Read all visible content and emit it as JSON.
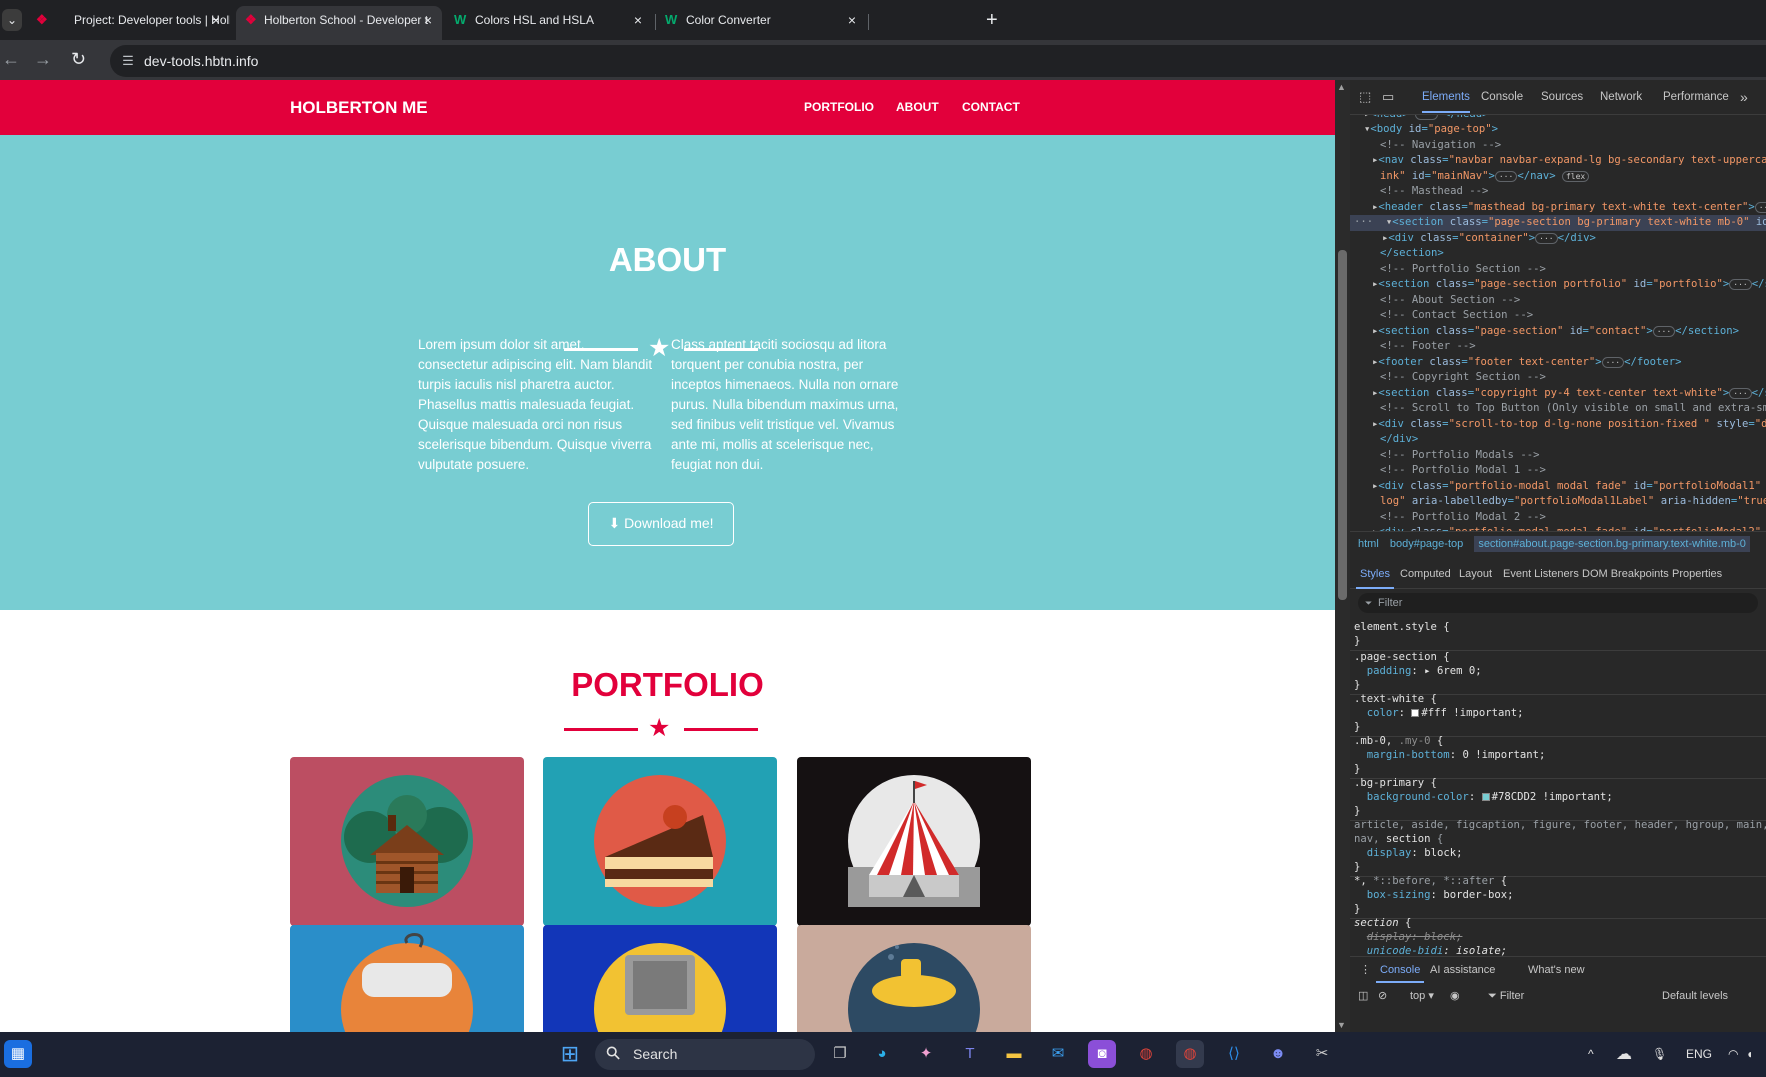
{
  "browser": {
    "tabs": [
      {
        "title": "Project: Developer tools | Holbe",
        "favicon": "holberton-icon",
        "close": "×"
      },
      {
        "title": "Holberton School - Developer t",
        "favicon": "holberton-icon",
        "close": "×"
      },
      {
        "title": "Colors HSL and HSLA",
        "favicon": "w3schools-icon",
        "close": "×"
      },
      {
        "title": "Color Converter",
        "favicon": "w3schools-icon",
        "close": "×"
      }
    ],
    "url": "dev-tools.hbtn.info"
  },
  "site": {
    "brand": "HOLBERTON ME",
    "nav": [
      "PORTFOLIO",
      "ABOUT",
      "CONTACT"
    ],
    "about": {
      "title": "ABOUT",
      "col1": "Lorem ipsum dolor sit amet, consectetur adipiscing elit. Nam blandit turpis iaculis nisl pharetra auctor. Phasellus mattis malesuada feugiat. Quisque malesuada orci non risus scelerisque bibendum. Quisque viverra vulputate posuere.",
      "col2": "Class aptent taciti sociosqu ad litora torquent per conubia nostra, per inceptos himenaeos. Nulla non ornare purus. Nulla bibendum maximus urna, sed finibus velit tristique vel. Vivamus ante mi, mollis at scelerisque nec, feugiat non dui.",
      "download": "Download me!",
      "background": "#78CDD2"
    },
    "portfolio": {
      "title": "PORTFOLIO",
      "items": [
        "cabin",
        "cake",
        "circus",
        "game-controller",
        "safe",
        "submarine"
      ]
    },
    "colors": {
      "primary": "#78CDD2",
      "secondary": "#E2003B"
    }
  },
  "devtools": {
    "tabs": [
      "Elements",
      "Console",
      "Sources",
      "Network",
      "Performance",
      "»"
    ],
    "breadcrumbs": [
      "html",
      "body#page-top",
      "section#about.page-section.bg-primary.text-white.mb-0"
    ],
    "sub_tabs": [
      "Styles",
      "Computed",
      "Layout",
      "Event Listeners",
      "DOM Breakpoints",
      "Properties"
    ],
    "filter_placeholder": "Filter",
    "drawer_tabs": [
      "Console",
      "AI assistance",
      "What's new"
    ],
    "console_context": "top ▾",
    "console_filter": "Filter",
    "console_levels": "Default levels"
  },
  "taskbar": {
    "search": "Search",
    "lang": "ENG"
  }
}
